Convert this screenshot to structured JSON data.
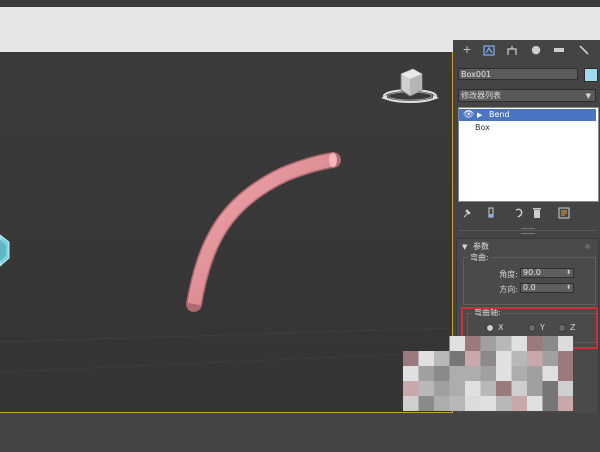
{
  "colors": {
    "background": "#444444",
    "viewport": "#383838",
    "viewport_border": "#c9a227",
    "tube": "#e08e95",
    "selected_row": "#4a75c2",
    "highlight_rect": "#c8303a",
    "object_color": "#9fdcef"
  },
  "command_panel": {
    "tab_icons": [
      "create-icon",
      "modify-icon",
      "hierarchy-icon",
      "motion-icon",
      "display-icon",
      "utilities-icon"
    ],
    "object_name": "Box001",
    "modifier_list_label": "修改器列表",
    "stack": [
      {
        "label": "Bend",
        "selected": true
      },
      {
        "label": "Box",
        "selected": false
      }
    ],
    "stack_tools": [
      "pin-stack-icon",
      "show-end-result-icon",
      "make-unique-icon",
      "remove-modifier-icon",
      "configure-modifier-sets-icon"
    ]
  },
  "parameters": {
    "title": "参数",
    "bend_group_label": "弯曲:",
    "angle_label": "角度:",
    "angle_value": "90.0",
    "direction_label": "方向:",
    "direction_value": "0.0",
    "axis_group_label": "弯曲轴:",
    "axes": [
      {
        "label": "X",
        "selected": true
      },
      {
        "label": "Y",
        "selected": false
      },
      {
        "label": "Z",
        "selected": false
      }
    ]
  }
}
